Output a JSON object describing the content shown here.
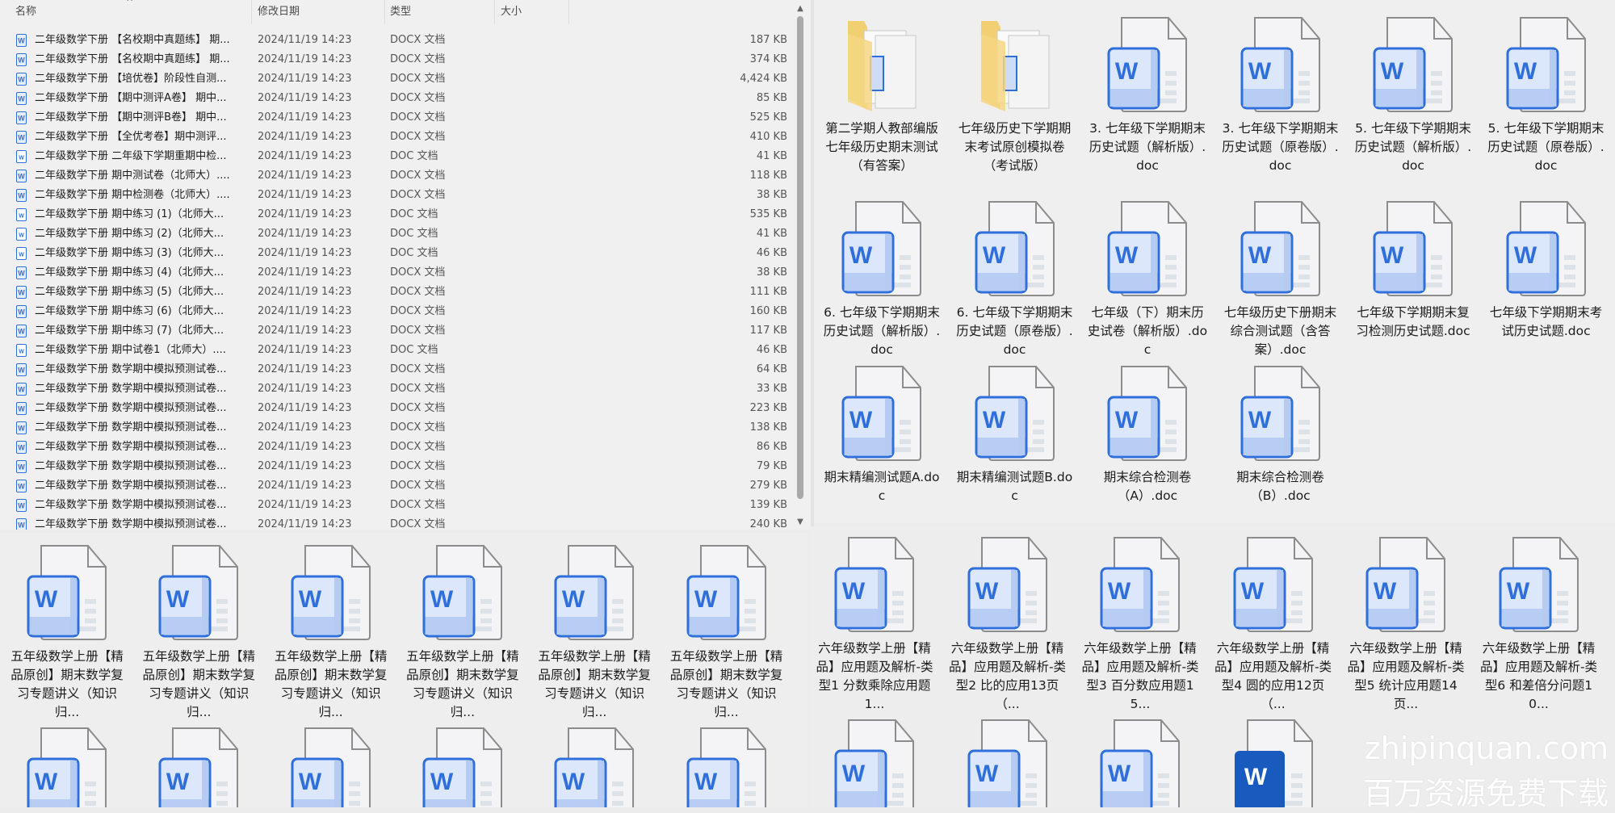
{
  "list": {
    "headers": {
      "name": "名称",
      "date": "修改日期",
      "type": "类型",
      "size": "大小"
    },
    "rows": [
      {
        "name": "二年级数学下册 【名校期中真题练】 期...",
        "date": "2024/11/19 14:23",
        "type": "DOCX 文档",
        "size": "187 KB",
        "icon": "docx"
      },
      {
        "name": "二年级数学下册 【名校期中真题练】 期...",
        "date": "2024/11/19 14:23",
        "type": "DOCX 文档",
        "size": "374 KB",
        "icon": "docx"
      },
      {
        "name": "二年级数学下册 【培优卷】阶段性自测...",
        "date": "2024/11/19 14:23",
        "type": "DOCX 文档",
        "size": "4,424 KB",
        "icon": "docx"
      },
      {
        "name": "二年级数学下册 【期中测评A卷】 期中...",
        "date": "2024/11/19 14:23",
        "type": "DOCX 文档",
        "size": "85 KB",
        "icon": "docx"
      },
      {
        "name": "二年级数学下册 【期中测评B卷】 期中...",
        "date": "2024/11/19 14:23",
        "type": "DOCX 文档",
        "size": "525 KB",
        "icon": "docx"
      },
      {
        "name": "二年级数学下册 【全优考卷】期中测评...",
        "date": "2024/11/19 14:23",
        "type": "DOCX 文档",
        "size": "410 KB",
        "icon": "docx"
      },
      {
        "name": "二年级数学下册 二年级下学期重期中检...",
        "date": "2024/11/19 14:23",
        "type": "DOC 文档",
        "size": "41 KB",
        "icon": "doc"
      },
      {
        "name": "二年级数学下册 期中测试卷（北师大）....",
        "date": "2024/11/19 14:23",
        "type": "DOCX 文档",
        "size": "118 KB",
        "icon": "docx"
      },
      {
        "name": "二年级数学下册 期中检测卷（北师大）....",
        "date": "2024/11/19 14:23",
        "type": "DOCX 文档",
        "size": "38 KB",
        "icon": "docx"
      },
      {
        "name": "二年级数学下册 期中练习 (1)（北师大...",
        "date": "2024/11/19 14:23",
        "type": "DOC 文档",
        "size": "535 KB",
        "icon": "doc"
      },
      {
        "name": "二年级数学下册 期中练习 (2)（北师大...",
        "date": "2024/11/19 14:23",
        "type": "DOC 文档",
        "size": "41 KB",
        "icon": "doc"
      },
      {
        "name": "二年级数学下册 期中练习 (3)（北师大...",
        "date": "2024/11/19 14:23",
        "type": "DOC 文档",
        "size": "46 KB",
        "icon": "doc"
      },
      {
        "name": "二年级数学下册 期中练习 (4)（北师大...",
        "date": "2024/11/19 14:23",
        "type": "DOCX 文档",
        "size": "38 KB",
        "icon": "docx"
      },
      {
        "name": "二年级数学下册 期中练习 (5)（北师大...",
        "date": "2024/11/19 14:23",
        "type": "DOCX 文档",
        "size": "111 KB",
        "icon": "docx"
      },
      {
        "name": "二年级数学下册 期中练习 (6)（北师大...",
        "date": "2024/11/19 14:23",
        "type": "DOCX 文档",
        "size": "160 KB",
        "icon": "docx"
      },
      {
        "name": "二年级数学下册 期中练习 (7)（北师大...",
        "date": "2024/11/19 14:23",
        "type": "DOCX 文档",
        "size": "117 KB",
        "icon": "docx"
      },
      {
        "name": "二年级数学下册 期中试卷1（北师大）....",
        "date": "2024/11/19 14:23",
        "type": "DOC 文档",
        "size": "46 KB",
        "icon": "doc"
      },
      {
        "name": "二年级数学下册 数学期中模拟预测试卷...",
        "date": "2024/11/19 14:23",
        "type": "DOCX 文档",
        "size": "64 KB",
        "icon": "docx"
      },
      {
        "name": "二年级数学下册 数学期中模拟预测试卷...",
        "date": "2024/11/19 14:23",
        "type": "DOCX 文档",
        "size": "33 KB",
        "icon": "docx"
      },
      {
        "name": "二年级数学下册 数学期中模拟预测试卷...",
        "date": "2024/11/19 14:23",
        "type": "DOCX 文档",
        "size": "223 KB",
        "icon": "docx"
      },
      {
        "name": "二年级数学下册 数学期中模拟预测试卷...",
        "date": "2024/11/19 14:23",
        "type": "DOCX 文档",
        "size": "138 KB",
        "icon": "docx"
      },
      {
        "name": "二年级数学下册 数学期中模拟预测试卷...",
        "date": "2024/11/19 14:23",
        "type": "DOCX 文档",
        "size": "86 KB",
        "icon": "docx"
      },
      {
        "name": "二年级数学下册 数学期中模拟预测试卷...",
        "date": "2024/11/19 14:23",
        "type": "DOCX 文档",
        "size": "79 KB",
        "icon": "docx"
      },
      {
        "name": "二年级数学下册 数学期中模拟预测试卷...",
        "date": "2024/11/19 14:23",
        "type": "DOCX 文档",
        "size": "279 KB",
        "icon": "docx"
      },
      {
        "name": "二年级数学下册 数学期中模拟预测试卷...",
        "date": "2024/11/19 14:23",
        "type": "DOCX 文档",
        "size": "139 KB",
        "icon": "docx"
      },
      {
        "name": "二年级数学下册 数学期中模拟预测试卷...",
        "date": "2024/11/19 14:23",
        "type": "DOCX 文档",
        "size": "240 KB",
        "icon": "docx"
      }
    ]
  },
  "grid_top_right": [
    {
      "label": "第二学期人教部编版七年级历史期末测试（有答案）",
      "icon": "folder"
    },
    {
      "label": "七年级历史下学期期末考试原创模拟卷（考试版）",
      "icon": "folder"
    },
    {
      "label": "3. 七年级下学期期末历史试题（解析版）.doc",
      "icon": "word"
    },
    {
      "label": "3. 七年级下学期期末历史试题（原卷版）.doc",
      "icon": "word"
    },
    {
      "label": "5. 七年级下学期期末历史试题（解析版）.doc",
      "icon": "word"
    },
    {
      "label": "5. 七年级下学期期末历史试题（原卷版）.doc",
      "icon": "word"
    },
    {
      "label": "6. 七年级下学期期末历史试题（解析版）.doc",
      "icon": "word"
    },
    {
      "label": "6. 七年级下学期期末历史试题（原卷版）.doc",
      "icon": "word"
    },
    {
      "label": "七年级（下）期末历史试卷（解析版）.doc",
      "icon": "word"
    },
    {
      "label": "七年级历史下册期末综合测试题（含答案）.doc",
      "icon": "word"
    },
    {
      "label": "七年级下学期期末复习检测历史试题.doc",
      "icon": "word"
    },
    {
      "label": "七年级下学期期末考试历史试题.doc",
      "icon": "word"
    },
    {
      "label": "期末精编测试题A.doc",
      "icon": "word"
    },
    {
      "label": "期末精编测试题B.doc",
      "icon": "word"
    },
    {
      "label": "期末综合检测卷（A）.doc",
      "icon": "word"
    },
    {
      "label": "期末综合检测卷（B）.doc",
      "icon": "word"
    }
  ],
  "grid_bottom_left": [
    {
      "label": "五年级数学上册【精品原创】期末数学复习专题讲义（知识归...",
      "icon": "word"
    },
    {
      "label": "五年级数学上册【精品原创】期末数学复习专题讲义（知识归...",
      "icon": "word"
    },
    {
      "label": "五年级数学上册【精品原创】期末数学复习专题讲义（知识归...",
      "icon": "word"
    },
    {
      "label": "五年级数学上册【精品原创】期末数学复习专题讲义（知识归...",
      "icon": "word"
    },
    {
      "label": "五年级数学上册【精品原创】期末数学复习专题讲义（知识归...",
      "icon": "word"
    },
    {
      "label": "五年级数学上册【精品原创】期末数学复习专题讲义（知识归...",
      "icon": "word"
    },
    {
      "label": "",
      "icon": "word"
    },
    {
      "label": "",
      "icon": "word"
    },
    {
      "label": "",
      "icon": "word"
    },
    {
      "label": "",
      "icon": "word"
    },
    {
      "label": "",
      "icon": "word"
    },
    {
      "label": "",
      "icon": "word"
    }
  ],
  "grid_bottom_right": [
    {
      "label": "六年级数学上册【精品】应用题及解析-类型1 分数乘除应用题1...",
      "icon": "word"
    },
    {
      "label": "六年级数学上册【精品】应用题及解析-类型2 比的应用13页（...",
      "icon": "word"
    },
    {
      "label": "六年级数学上册【精品】应用题及解析-类型3 百分数应用题15...",
      "icon": "word"
    },
    {
      "label": "六年级数学上册【精品】应用题及解析-类型4 圆的应用12页（...",
      "icon": "word"
    },
    {
      "label": "六年级数学上册【精品】应用题及解析-类型5 统计应用题14页...",
      "icon": "word"
    },
    {
      "label": "六年级数学上册【精品】应用题及解析-类型6 和差倍分问题10...",
      "icon": "word"
    },
    {
      "label": "",
      "icon": "word"
    },
    {
      "label": "",
      "icon": "word"
    },
    {
      "label": "",
      "icon": "word"
    },
    {
      "label": "",
      "icon": "word-solid"
    }
  ],
  "watermark": {
    "line1": "zhipinquan.com",
    "line2": "百万资源免费下载"
  },
  "colors": {
    "word_blue": "#2f6fdc",
    "word_solid": "#185abd",
    "folder": "#f2cf72"
  }
}
